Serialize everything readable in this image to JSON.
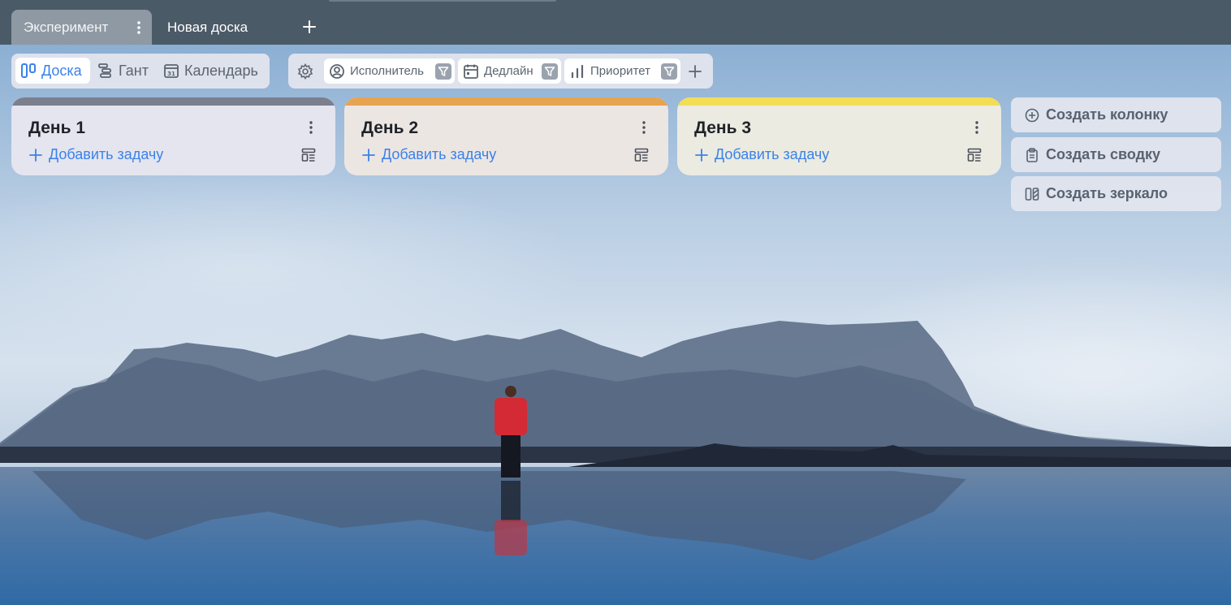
{
  "tabs": [
    {
      "label": "Эксперимент",
      "active": true
    },
    {
      "label": "Новая доска",
      "active": false
    }
  ],
  "add_tab_icon": "plus-icon",
  "views": {
    "board": "Доска",
    "gantt": "Гант",
    "calendar": "Календарь",
    "active": "board"
  },
  "filters": [
    {
      "label": "Исполнитель",
      "icon": "user-circle-icon"
    },
    {
      "label": "Дедлайн",
      "icon": "calendar-icon"
    },
    {
      "label": "Приоритет",
      "icon": "bar-chart-icon"
    }
  ],
  "columns": [
    {
      "title": "День 1",
      "add_label": "Добавить задачу",
      "color": "#7c7f8d"
    },
    {
      "title": "День 2",
      "add_label": "Добавить задачу",
      "color": "#e7a44f"
    },
    {
      "title": "День 3",
      "add_label": "Добавить задачу",
      "color": "#f3dd55"
    }
  ],
  "actions": {
    "create_column": "Создать колонку",
    "create_summary": "Создать сводку",
    "create_mirror": "Создать зеркало"
  },
  "colors": {
    "accent": "#3b82e8",
    "tabbar": "#4b5a67"
  }
}
